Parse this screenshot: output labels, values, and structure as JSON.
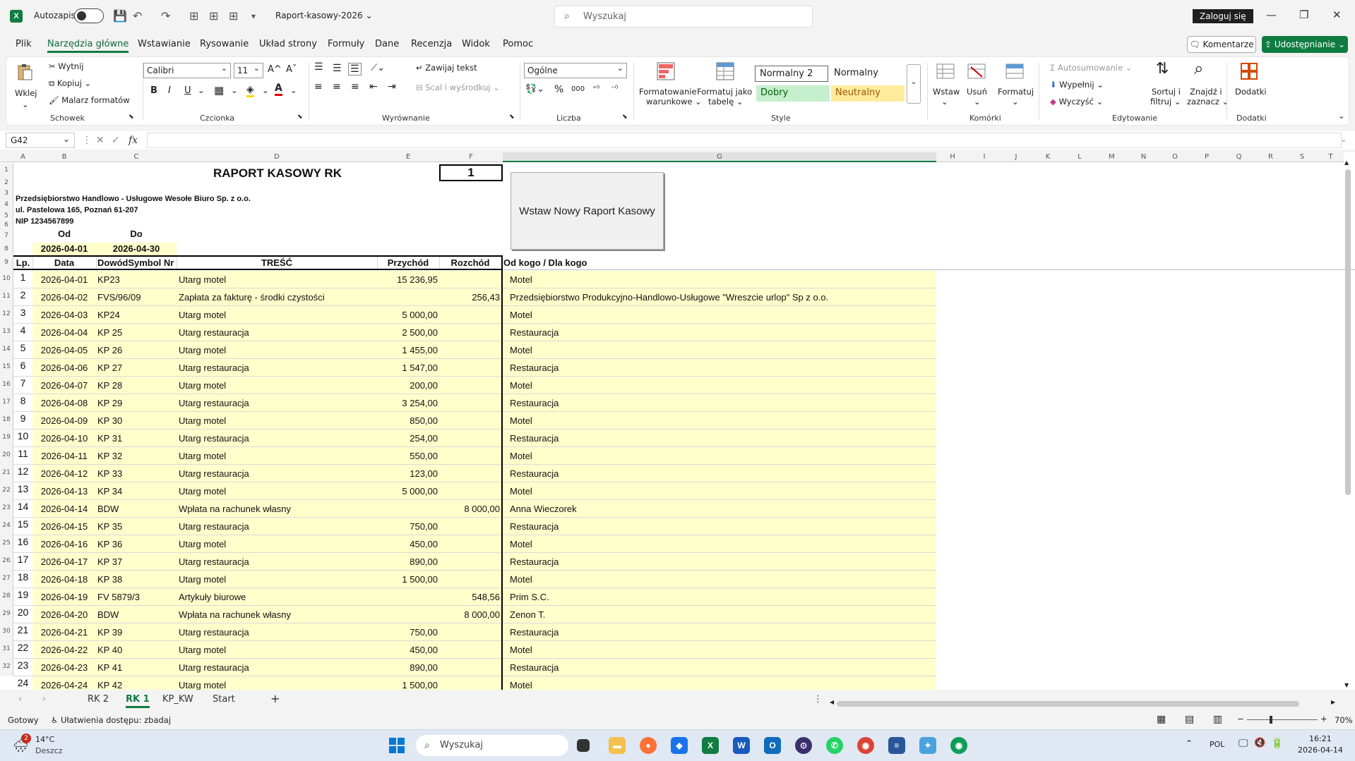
{
  "title_bar": {
    "app_logo": "X",
    "autosave_label": "Autozapis",
    "doc_title": "Raport-kasowy-2026",
    "search_placeholder": "Wyszukaj",
    "signin_label": "Zaloguj się",
    "minimize": "—",
    "restore": "❐",
    "close": "✕"
  },
  "menu": {
    "items": [
      "Plik",
      "Narzędzia główne",
      "Wstawianie",
      "Rysowanie",
      "Układ strony",
      "Formuły",
      "Dane",
      "Recenzja",
      "Widok",
      "Pomoc"
    ],
    "comments_label": "Komentarze",
    "share_label": "Udostępnianie"
  },
  "ribbon": {
    "paste": "Wklej",
    "cut": "Wytnij",
    "copy": "Kopiuj",
    "format_painter": "Malarz formatów",
    "group_clipboard": "Schowek",
    "font_name": "Calibri",
    "font_size": "11",
    "grow_font": "A^",
    "shrink_font": "Aˇ",
    "bold": "B",
    "italic": "I",
    "underline": "U",
    "group_font": "Czcionka",
    "wrap_text": "Zawijaj tekst",
    "merge_center": "Scal i wyśrodkuj",
    "group_alignment": "Wyrównanie",
    "number_format": "Ogólne",
    "group_number": "Liczba",
    "cond_format_1": "Formatowanie",
    "cond_format_2": "warunkowe",
    "format_table_1": "Formatuj jako",
    "format_table_2": "tabelę",
    "style_normal2": "Normalny 2",
    "style_normal": "Normalny",
    "style_good": "Dobry",
    "style_neutral": "Neutralny",
    "group_styles": "Style",
    "insert": "Wstaw",
    "delete": "Usuń",
    "format": "Formatuj",
    "group_cells": "Komórki",
    "autosum": "Autosumowanie",
    "fill": "Wypełnij",
    "clear": "Wyczyść",
    "sort_filter_1": "Sortuj i",
    "sort_filter_2": "filtruj",
    "find_select_1": "Znajdź i",
    "find_select_2": "zaznacz",
    "group_editing": "Edytowanie",
    "addins": "Dodatki",
    "group_addins": "Dodatki"
  },
  "formula_bar": {
    "name_box": "G42",
    "fx": "fx",
    "value": ""
  },
  "columns": [
    "A",
    "B",
    "C",
    "D",
    "E",
    "F",
    "G",
    "H",
    "I",
    "J",
    "K",
    "L",
    "M",
    "N",
    "O",
    "P",
    "Q",
    "R",
    "S",
    "T"
  ],
  "sheet": {
    "title": "RAPORT KASOWY RK",
    "report_no": "1",
    "company": "Przedsiębiorstwo Handlowo - Usługowe Wesołe Biuro Sp. z o.o.",
    "address": "ul. Pastelowa 165, Poznań 61-207",
    "nip": "NIP 1234567899",
    "from_label": "Od",
    "to_label": "Do",
    "from_date": "2026-04-01",
    "to_date": "2026-04-30",
    "insert_button": "Wstaw Nowy Raport Kasowy",
    "headers": {
      "lp": "Lp.",
      "date": "Data",
      "doc": "DowódSymbol Nr",
      "desc": "TREŚĆ",
      "income": "Przychód",
      "expense": "Rozchód",
      "party": "Od kogo / Dla kogo"
    },
    "rows": [
      {
        "lp": "1",
        "date": "2026-04-01",
        "doc": "KP23",
        "desc": "Utarg motel",
        "income": "15 236,95",
        "expense": "",
        "party": "Motel"
      },
      {
        "lp": "2",
        "date": "2026-04-02",
        "doc": "FVS/96/09",
        "desc": "Zapłata za fakturę - środki czystości",
        "income": "",
        "expense": "256,43",
        "party": "Przedsiębiorstwo Produkcyjno-Handlowo-Usługowe \"Wreszcie urlop\" Sp z o.o."
      },
      {
        "lp": "3",
        "date": "2026-04-03",
        "doc": "KP24",
        "desc": "Utarg motel",
        "income": "5 000,00",
        "expense": "",
        "party": "Motel"
      },
      {
        "lp": "4",
        "date": "2026-04-04",
        "doc": "KP 25",
        "desc": "Utarg restauracja",
        "income": "2 500,00",
        "expense": "",
        "party": "Restauracja"
      },
      {
        "lp": "5",
        "date": "2026-04-05",
        "doc": "KP 26",
        "desc": "Utarg motel",
        "income": "1 455,00",
        "expense": "",
        "party": "Motel"
      },
      {
        "lp": "6",
        "date": "2026-04-06",
        "doc": "KP 27",
        "desc": "Utarg restauracja",
        "income": "1 547,00",
        "expense": "",
        "party": "Restauracja"
      },
      {
        "lp": "7",
        "date": "2026-04-07",
        "doc": "KP 28",
        "desc": "Utarg motel",
        "income": "200,00",
        "expense": "",
        "party": "Motel"
      },
      {
        "lp": "8",
        "date": "2026-04-08",
        "doc": "KP 29",
        "desc": "Utarg restauracja",
        "income": "3 254,00",
        "expense": "",
        "party": "Restauracja"
      },
      {
        "lp": "9",
        "date": "2026-04-09",
        "doc": "KP 30",
        "desc": "Utarg motel",
        "income": "850,00",
        "expense": "",
        "party": "Motel"
      },
      {
        "lp": "10",
        "date": "2026-04-10",
        "doc": "KP 31",
        "desc": "Utarg restauracja",
        "income": "254,00",
        "expense": "",
        "party": "Restauracja"
      },
      {
        "lp": "11",
        "date": "2026-04-11",
        "doc": "KP 32",
        "desc": "Utarg motel",
        "income": "550,00",
        "expense": "",
        "party": "Motel"
      },
      {
        "lp": "12",
        "date": "2026-04-12",
        "doc": "KP 33",
        "desc": "Utarg restauracja",
        "income": "123,00",
        "expense": "",
        "party": "Restauracja"
      },
      {
        "lp": "13",
        "date": "2026-04-13",
        "doc": "KP 34",
        "desc": "Utarg motel",
        "income": "5 000,00",
        "expense": "",
        "party": "Motel"
      },
      {
        "lp": "14",
        "date": "2026-04-14",
        "doc": "BDW",
        "desc": "Wpłata na rachunek  własny",
        "income": "",
        "expense": "8 000,00",
        "party": "Anna Wieczorek"
      },
      {
        "lp": "15",
        "date": "2026-04-15",
        "doc": "KP 35",
        "desc": "Utarg restauracja",
        "income": "750,00",
        "expense": "",
        "party": "Restauracja"
      },
      {
        "lp": "16",
        "date": "2026-04-16",
        "doc": "KP 36",
        "desc": "Utarg motel",
        "income": "450,00",
        "expense": "",
        "party": "Motel"
      },
      {
        "lp": "17",
        "date": "2026-04-17",
        "doc": "KP 37",
        "desc": "Utarg restauracja",
        "income": "890,00",
        "expense": "",
        "party": "Restauracja"
      },
      {
        "lp": "18",
        "date": "2026-04-18",
        "doc": "KP 38",
        "desc": "Utarg motel",
        "income": "1 500,00",
        "expense": "",
        "party": "Motel"
      },
      {
        "lp": "19",
        "date": "2026-04-19",
        "doc": "FV 5879/3",
        "desc": "Artykuły biurowe",
        "income": "",
        "expense": "548,56",
        "party": "Prim S.C."
      },
      {
        "lp": "20",
        "date": "2026-04-20",
        "doc": "BDW",
        "desc": "Wpłata na rachunek  własny",
        "income": "",
        "expense": "8 000,00",
        "party": "Zenon T."
      },
      {
        "lp": "21",
        "date": "2026-04-21",
        "doc": "KP 39",
        "desc": "Utarg restauracja",
        "income": "750,00",
        "expense": "",
        "party": "Restauracja"
      },
      {
        "lp": "22",
        "date": "2026-04-22",
        "doc": "KP 40",
        "desc": "Utarg motel",
        "income": "450,00",
        "expense": "",
        "party": "Motel"
      },
      {
        "lp": "23",
        "date": "2026-04-23",
        "doc": "KP 41",
        "desc": "Utarg restauracja",
        "income": "890,00",
        "expense": "",
        "party": "Restauracja"
      },
      {
        "lp": "24",
        "date": "2026-04-24",
        "doc": "KP 42",
        "desc": "Utarg motel",
        "income": "1 500,00",
        "expense": "",
        "party": "Motel"
      }
    ]
  },
  "sheet_tabs": {
    "tabs": [
      "RK 2",
      "RK 1",
      "KP_KW",
      "Start"
    ],
    "active": "RK 1",
    "add": "+"
  },
  "status": {
    "ready": "Gotowy",
    "accessibility": "Ułatwienia dostępu: zbadaj",
    "zoom": "70%"
  },
  "taskbar": {
    "weather_temp": "14°C",
    "weather_desc": "Deszcz",
    "weather_badge": "2",
    "search": "Wyszukaj",
    "lang": "POL",
    "time": "16:21",
    "date": "2026-04-14"
  },
  "colors": {
    "excel_green": "#107c41",
    "cell_yellow": "#ffffcc",
    "style_good_bg": "#c6efce",
    "style_neutral_bg": "#ffeb9c"
  }
}
